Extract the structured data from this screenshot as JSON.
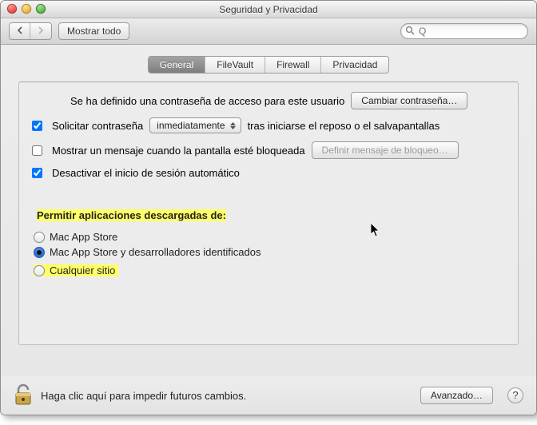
{
  "window": {
    "title": "Seguridad y Privacidad"
  },
  "toolbar": {
    "show_all": "Mostrar todo",
    "search_placeholder": "Q"
  },
  "tabs": [
    {
      "label": "General",
      "selected": true
    },
    {
      "label": "FileVault",
      "selected": false
    },
    {
      "label": "Firewall",
      "selected": false
    },
    {
      "label": "Privacidad",
      "selected": false
    }
  ],
  "general": {
    "password_defined": "Se ha definido una contraseña de acceso para este usuario",
    "change_password_btn": "Cambiar contraseña…",
    "require_password_pre": "Solicitar contraseña",
    "require_password_delay_options": [
      "inmediatamente"
    ],
    "require_password_delay_selected": "inmediatamente",
    "require_password_post": "tras iniciarse el reposo o el salvapantallas",
    "require_password_checked": true,
    "show_message": "Mostrar un mensaje cuando la pantalla esté bloqueada",
    "show_message_checked": false,
    "set_lock_message_btn": "Definir mensaje de bloqueo…",
    "disable_autologin": "Desactivar el inicio de sesión automático",
    "disable_autologin_checked": true,
    "allow_apps_heading": "Permitir aplicaciones descargadas de:",
    "allow_apps_options": [
      {
        "label": "Mac App Store",
        "value": "mas"
      },
      {
        "label": "Mac App Store y desarrolladores identificados",
        "value": "mas_dev"
      },
      {
        "label": "Cualquier sitio",
        "value": "anywhere"
      }
    ],
    "allow_apps_selected": "mas_dev"
  },
  "footer": {
    "lock_hint": "Haga clic aquí para impedir futuros cambios.",
    "advanced_btn": "Avanzado…"
  }
}
